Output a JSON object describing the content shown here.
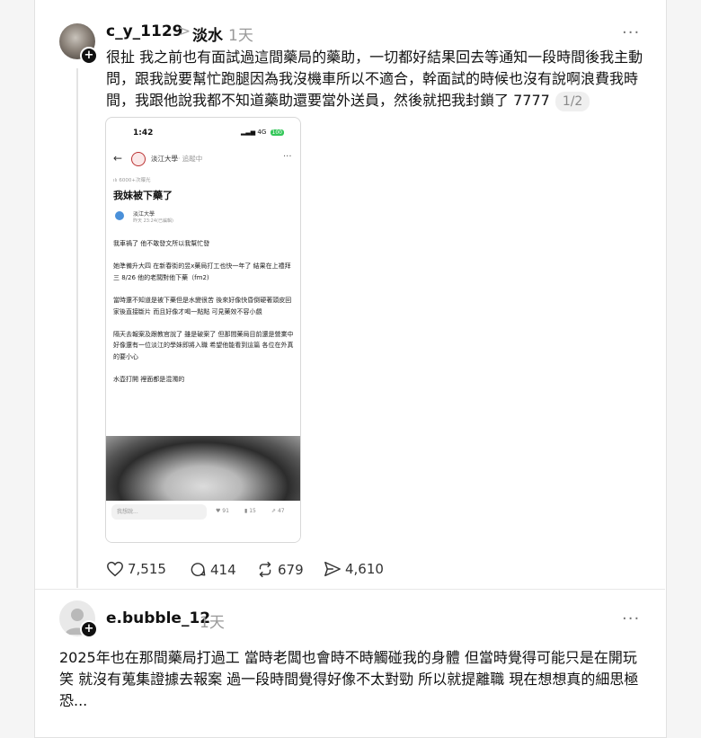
{
  "post1": {
    "username": "c_y_1129",
    "separator": ">",
    "board": "淡水",
    "time": "1天",
    "more": "···",
    "text": "很扯 我之前也有面試過這間藥局的藥助，一切都好結果回去等通知一段時間後我主動問，跟我說要幫忙跑腿因為我沒機車所以不適合，幹面試的時候也沒有說啊浪費我時間，我跟他說我都不知道藥助還要當外送員，然後就把我封鎖了 7777",
    "page_indicator": "1/2",
    "actions": {
      "likes": "7,515",
      "comments": "414",
      "reposts": "679",
      "shares": "4,610"
    }
  },
  "screenshot": {
    "time": "1:42",
    "signal": "4G",
    "battery": "100",
    "board": "淡江大學",
    "follow": "· 追蹤中",
    "views": "6000+次曝光",
    "title": "我妹被下藥了",
    "author": "淡江大學",
    "author_time": "昨天 23:24(已編輯)",
    "paragraphs": [
      "我車禍了 他不敢發文所以我幫忙發",
      "她準備升大四 在新春街的昱x藥局打工也快一年了 結果在上禮拜三 8/26 他的老闆對他下藥（fm2)",
      "當時還不知道是被下藥但是水變很苦 後來好像快昏倒硬著頭皮回家後直接斷片 而且好像才喝一點點 可見藥效不容小覷",
      "隔天去報案及跟教官說了 雖是破案了 但那間藥局目前還是營業中 好像還有一位淡江的學妹即將入職 希望他能看到這篇 各位在外真的要小心",
      "水壺打開 裡面都是混濁的"
    ],
    "input_placeholder": "我想說...",
    "likes": "91",
    "saves": "15",
    "shares": "47"
  },
  "post2": {
    "username": "e.bubble_12",
    "time": "1天",
    "more": "···",
    "text": "2025年也在那間藥局打過工 當時老闆也會時不時觸碰我的身體 但當時覺得可能只是在開玩笑 就沒有蒐集證據去報案 過一段時間覺得好像不太對勁 所以就提離職 現在想想真的細思極恐..."
  }
}
